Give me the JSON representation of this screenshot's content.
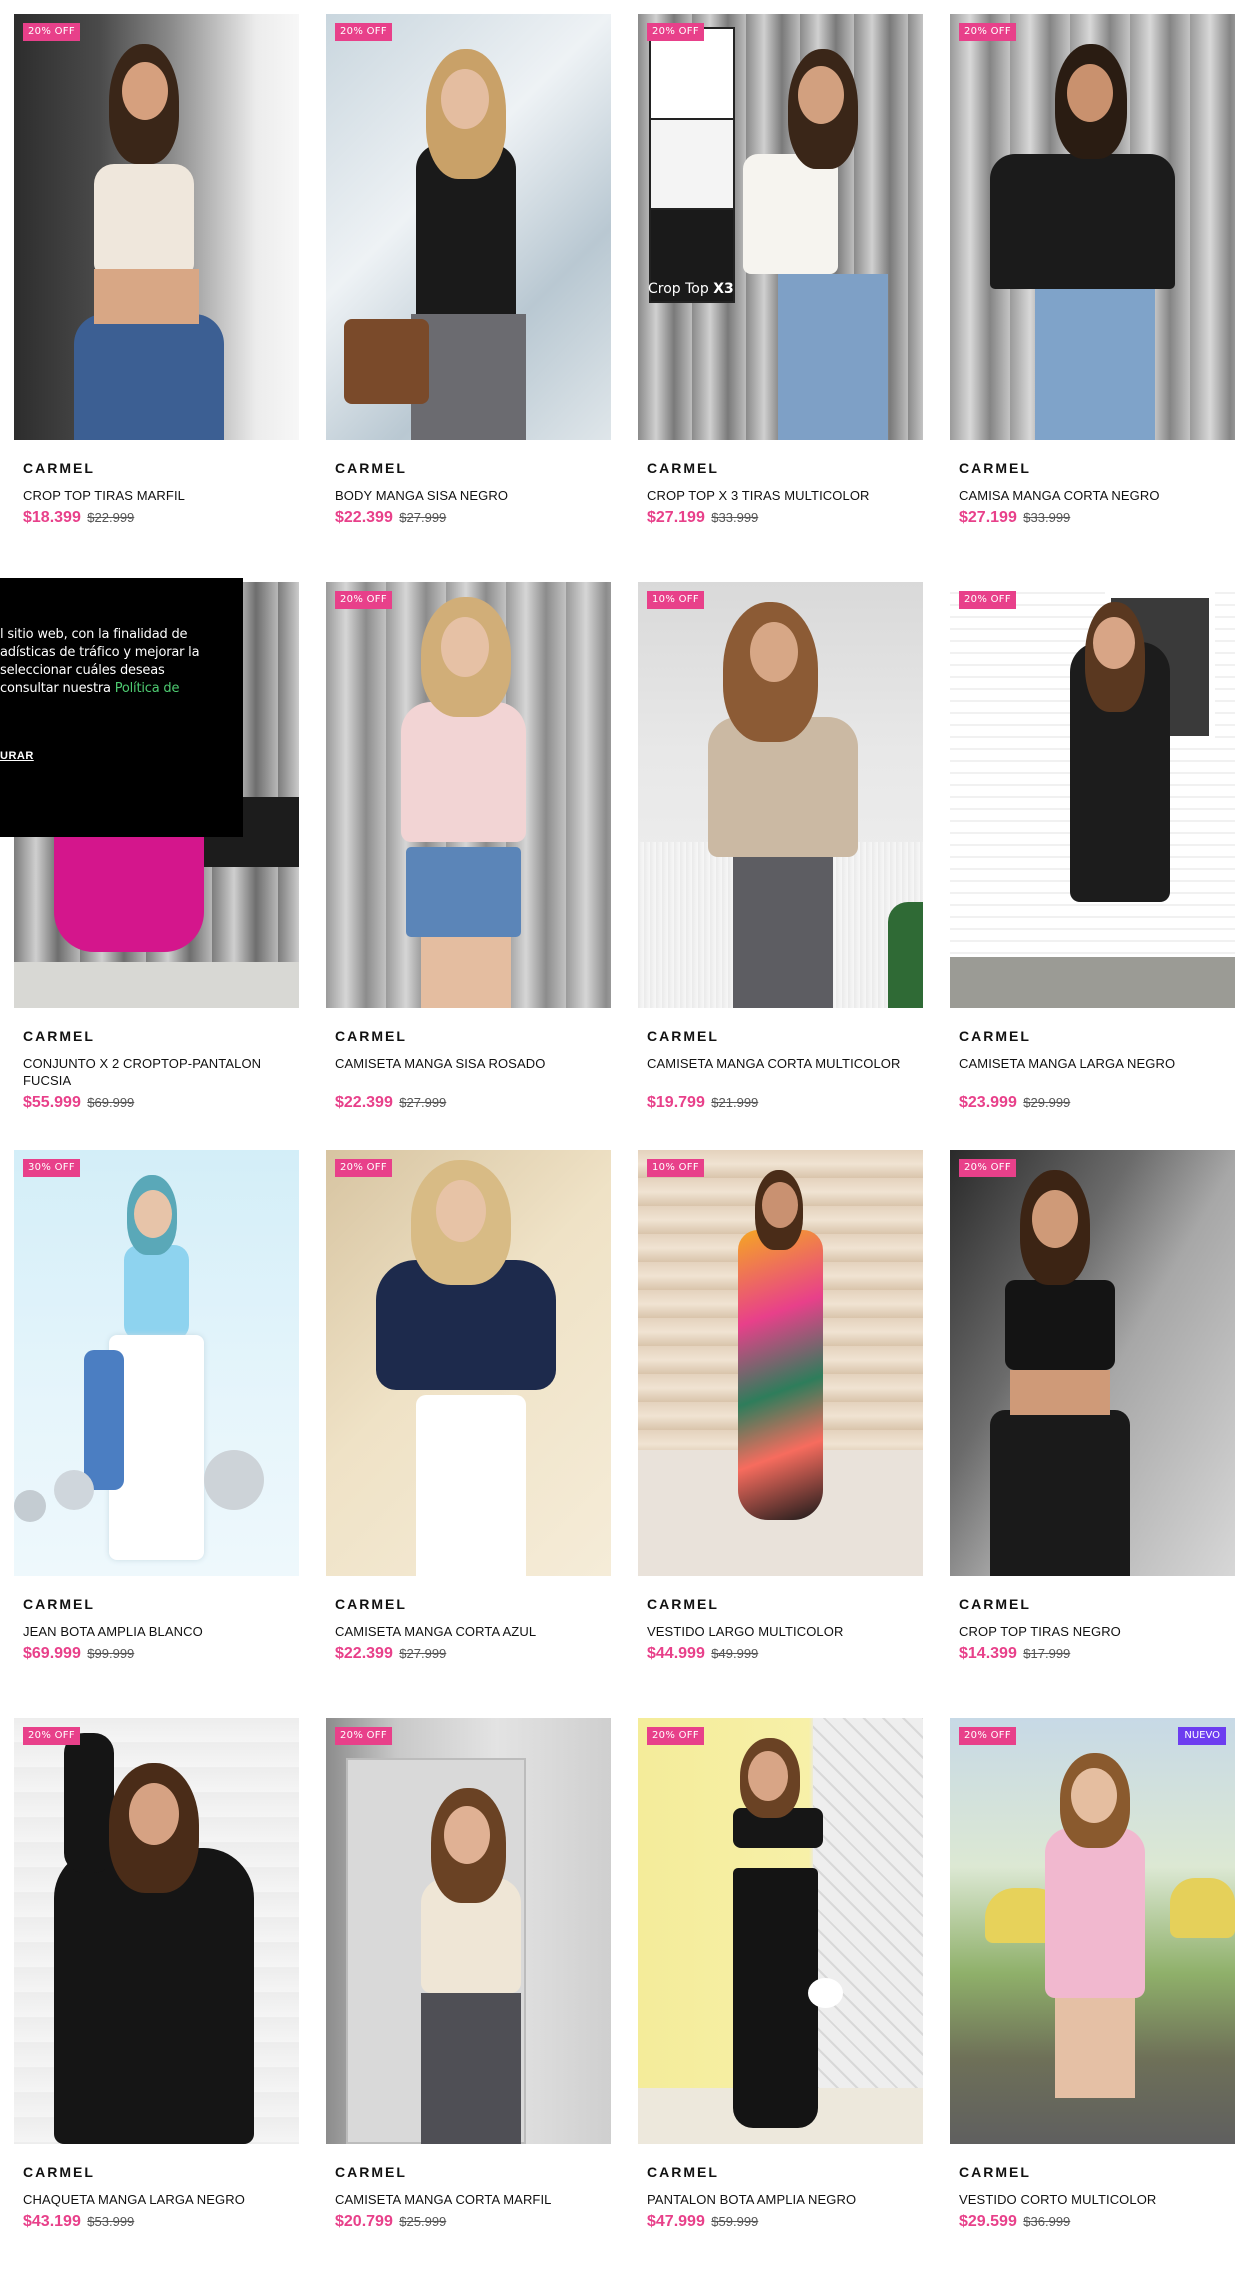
{
  "colors": {
    "accent_pink": "#e8408a",
    "new_purple": "#6d3df0",
    "cookie_link_green": "#4ecb71"
  },
  "cookie": {
    "line1": "l sitio web, con la finalidad de",
    "line2": "adísticas de tráfico y mejorar la",
    "line3": "seleccionar cuáles deseas",
    "line4": "consultar nuestra",
    "link": "Política de",
    "button": "URAR"
  },
  "products": [
    {
      "badge": "20% OFF",
      "brand": "CARMEL",
      "title": "CROP TOP TIRAS MARFIL",
      "price": "$18.399",
      "old_price": "$22.999"
    },
    {
      "badge": "20% OFF",
      "brand": "CARMEL",
      "title": "BODY MANGA SISA NEGRO",
      "price": "$22.399",
      "old_price": "$27.999"
    },
    {
      "badge": "20% OFF",
      "brand": "CARMEL",
      "title": "CROP TOP X 3 TIRAS MULTICOLOR",
      "price": "$27.199",
      "old_price": "$33.999",
      "image_label": "Crop Top",
      "image_label_bold": "X3"
    },
    {
      "badge": "20% OFF",
      "brand": "CARMEL",
      "title": "CAMISA MANGA CORTA NEGRO",
      "price": "$27.199",
      "old_price": "$33.999"
    },
    {
      "badge": "",
      "brand": "CARMEL",
      "title": "CONJUNTO X 2 CROPTOP-PANTALON FUCSIA",
      "price": "$55.999",
      "old_price": "$69.999"
    },
    {
      "badge": "20% OFF",
      "brand": "CARMEL",
      "title": "CAMISETA MANGA SISA ROSADO",
      "price": "$22.399",
      "old_price": "$27.999"
    },
    {
      "badge": "10% OFF",
      "brand": "CARMEL",
      "title": "CAMISETA MANGA CORTA MULTICOLOR",
      "price": "$19.799",
      "old_price": "$21.999"
    },
    {
      "badge": "20% OFF",
      "brand": "CARMEL",
      "title": "CAMISETA MANGA LARGA NEGRO",
      "price": "$23.999",
      "old_price": "$29.999"
    },
    {
      "badge": "30% OFF",
      "brand": "CARMEL",
      "title": "JEAN BOTA AMPLIA BLANCO",
      "price": "$69.999",
      "old_price": "$99.999"
    },
    {
      "badge": "20% OFF",
      "brand": "CARMEL",
      "title": "CAMISETA MANGA CORTA AZUL",
      "price": "$22.399",
      "old_price": "$27.999"
    },
    {
      "badge": "10% OFF",
      "brand": "CARMEL",
      "title": "VESTIDO LARGO MULTICOLOR",
      "price": "$44.999",
      "old_price": "$49.999"
    },
    {
      "badge": "20% OFF",
      "brand": "CARMEL",
      "title": "CROP TOP TIRAS NEGRO",
      "price": "$14.399",
      "old_price": "$17.999"
    },
    {
      "badge": "20% OFF",
      "brand": "CARMEL",
      "title": "CHAQUETA MANGA LARGA NEGRO",
      "price": "$43.199",
      "old_price": "$53.999"
    },
    {
      "badge": "20% OFF",
      "brand": "CARMEL",
      "title": "CAMISETA MANGA CORTA MARFIL",
      "price": "$20.799",
      "old_price": "$25.999"
    },
    {
      "badge": "20% OFF",
      "brand": "CARMEL",
      "title": "PANTALON BOTA AMPLIA NEGRO",
      "price": "$47.999",
      "old_price": "$59.999"
    },
    {
      "badge": "20% OFF",
      "brand": "CARMEL",
      "title": "VESTIDO CORTO MULTICOLOR",
      "price": "$29.599",
      "old_price": "$36.999",
      "new_badge": "NUEVO"
    }
  ]
}
